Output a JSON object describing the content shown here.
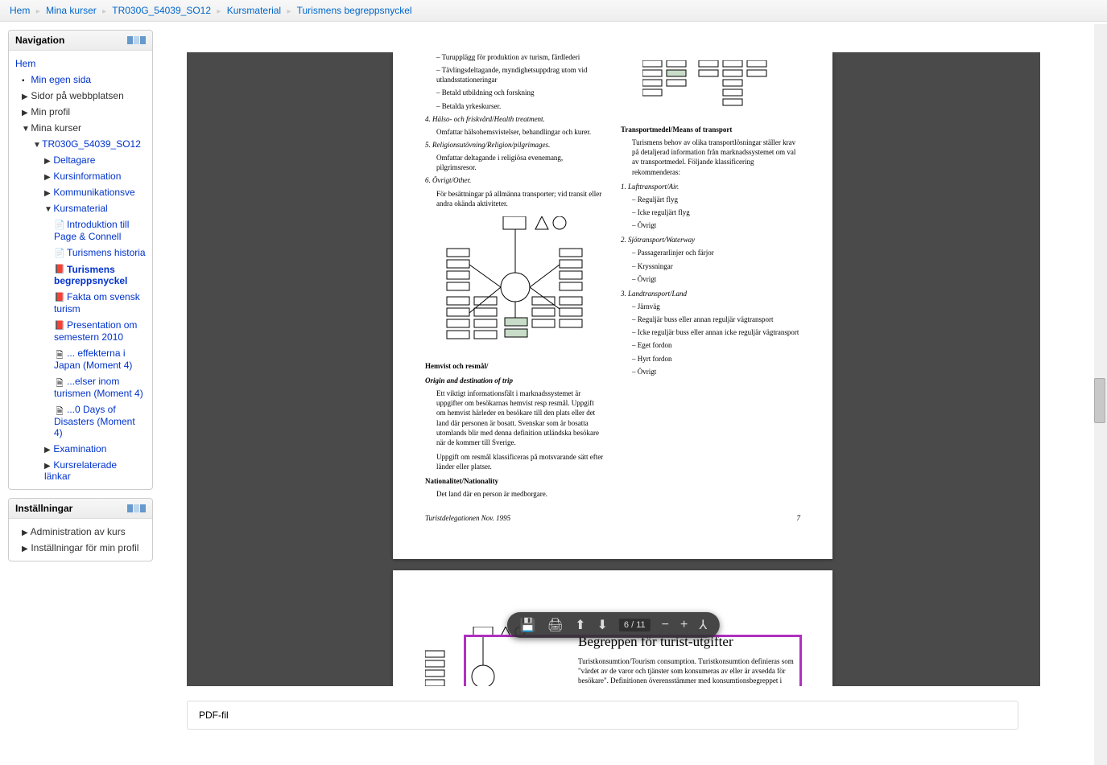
{
  "breadcrumb": [
    {
      "label": "Hem"
    },
    {
      "label": "Mina kurser"
    },
    {
      "label": "TR030G_54039_SO12"
    },
    {
      "label": "Kursmaterial"
    },
    {
      "label": "Turismens begreppsnyckel"
    }
  ],
  "blocks": {
    "nav_title": "Navigation",
    "settings_title": "Inställningar"
  },
  "nav": {
    "hem": "Hem",
    "min_sida": "Min egen sida",
    "sidor": "Sidor på webbplatsen",
    "min_profil": "Min profil",
    "mina_kurser": "Mina kurser",
    "course": "TR030G_54039_SO12",
    "deltagare": "Deltagare",
    "kursinfo": "Kursinformation",
    "komm": "Kommunikationsve",
    "kursmaterial": "Kursmaterial",
    "mat": {
      "intro": "Introduktion till Page & Connell",
      "hist": "Turismens historia",
      "begrepp": "Turismens begreppsnyckel",
      "fakta": "Fakta om svensk turism",
      "pres": "Presentation om semestern 2010",
      "japan": "... effekterna i Japan (Moment 4)",
      "elser": "...elser inom turismen (Moment 4)",
      "days": "...0 Days of Disasters (Moment 4)"
    },
    "exam": "Examination",
    "lankar": "Kursrelaterade länkar"
  },
  "settings": {
    "admin": "Administration av kurs",
    "profil": "Inställningar för min profil"
  },
  "pdf": {
    "p1": "– Turupplägg för produktion av turism, färdlederi",
    "p2": "– Tävlingsdeltagande, myndighetsuppdrag utom vid utlandsstationeringar",
    "p3": "– Betald utbildning och forskning",
    "p4": "– Betalda yrkeskurser.",
    "h4": "4. Hälso- och friskvård/Health treatment.",
    "h4t": "Omfattar hälsohemsvistelser, behandlingar och kurer.",
    "h5": "5. Religionsutövning/Religion/pilgrimages.",
    "h5t": "Omfattar deltagande i religiösa evenemang, pilgrimsresor.",
    "h6": "6. Övrigt/Other.",
    "h6t": "För besättningar på allmänna transporter; vid transit eller andra okända aktiviteter.",
    "hem_title": "Hemvist och resmål/",
    "hem_title2": "Origin and destination of trip",
    "hem_t1": "Ett viktigt informationsfält i marknadssystemet är uppgifter om besökarnas hemvist resp resmål. Uppgift om hemvist härleder en besökare till den plats eller det land där personen är bosatt. Svenskar som är bosatta utomlands blir med denna definition utländska besökare när de kommer till Sverige.",
    "hem_t2": "Uppgift om resmål klassificeras på motsvarande sätt efter länder eller platser.",
    "nat_title": "Nationalitet/Nationality",
    "nat_t": "Det land där en person är medborgare.",
    "trans_title": "Transportmedel/Means of transport",
    "trans_t": "Turismens behov av olika transportlösningar ställer krav på detaljerad information från marknadssystemet om val av transportmedel. Följande klassificering rekommenderas:",
    "t1": "1. Lufttransport/Air.",
    "t1a": "– Reguljärt flyg",
    "t1b": "– Icke reguljärt flyg",
    "t1c": "– Övrigt",
    "t2": "2. Sjötransport/Waterway",
    "t2a": "– Passagerarlinjer och färjor",
    "t2b": "– Kryssningar",
    "t2c": "– Övrigt",
    "t3": "3. Landtransport/Land",
    "t3a": "– Järnväg",
    "t3b": "– Reguljär buss eller annan reguljär vägtransport",
    "t3c": "– Icke reguljär buss eller annan icke reguljär vägtransport",
    "t3d": "– Eget fordon",
    "t3e": "– Hyrt fordon",
    "t3f": "– Övrigt",
    "foot_l": "Turistdelegationen Nov. 1995",
    "foot_r": "7",
    "p2title": "Begreppen för turist-utgifter",
    "p2text": "Turistkonsumtion/Tourism consumption. Turistkonsumtion definieras som \"värdet av de varor och tjänster som konsumeras av eller är avsedda för besökare\". Definitionen överensstämmer med konsumtionsbegreppet i natio-"
  },
  "toolbar": {
    "page": "6",
    "sep": "/",
    "total": "11"
  },
  "filetype": "PDF-fil"
}
